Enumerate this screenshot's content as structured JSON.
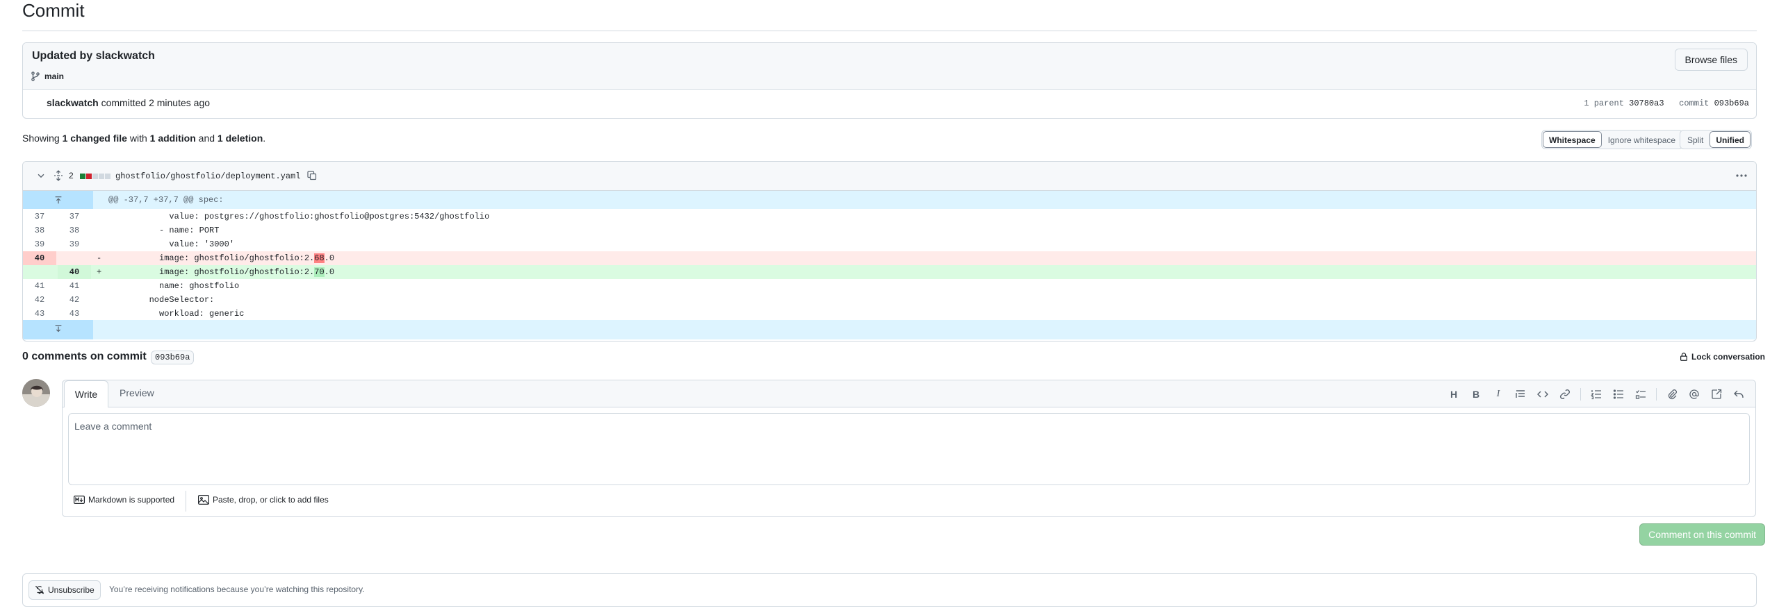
{
  "page": {
    "title": "Commit"
  },
  "commit": {
    "message": "Updated by slackwatch",
    "branch": "main",
    "browse_label": "Browse files",
    "author": "slackwatch",
    "committed_text": "committed 2 minutes ago",
    "parent_label": "1 parent",
    "parent_sha": "30780a3",
    "commit_label": "commit",
    "commit_sha": "093b69a"
  },
  "summary": {
    "prefix": "Showing",
    "changed": "1 changed file",
    "with": "with",
    "additions": "1 addition",
    "and": "and",
    "deletions": "1 deletion",
    "suffix": "."
  },
  "view_options": {
    "whitespace": "Whitespace",
    "ignore_whitespace": "Ignore whitespace",
    "split": "Split",
    "unified": "Unified"
  },
  "file": {
    "change_count": "2",
    "path": "ghostfolio/ghostfolio/deployment.yaml",
    "hunk_header": "@@ -37,7 +37,7 @@ spec:",
    "lines": [
      {
        "old": "37",
        "new": "37",
        "sign": "",
        "pre": "            value: postgres://ghostfolio:ghostfolio@postgres:5432/ghostfolio",
        "hl": "",
        "post": ""
      },
      {
        "old": "38",
        "new": "38",
        "sign": "",
        "pre": "          - name: PORT",
        "hl": "",
        "post": ""
      },
      {
        "old": "39",
        "new": "39",
        "sign": "",
        "pre": "            value: '3000'",
        "hl": "",
        "post": ""
      },
      {
        "old": "40",
        "new": "",
        "sign": "-",
        "pre": "          image: ghostfolio/ghostfolio:2.",
        "hl": "68",
        "post": ".0"
      },
      {
        "old": "",
        "new": "40",
        "sign": "+",
        "pre": "          image: ghostfolio/ghostfolio:2.",
        "hl": "70",
        "post": ".0"
      },
      {
        "old": "41",
        "new": "41",
        "sign": "",
        "pre": "          name: ghostfolio",
        "hl": "",
        "post": ""
      },
      {
        "old": "42",
        "new": "42",
        "sign": "",
        "pre": "        nodeSelector:",
        "hl": "",
        "post": ""
      },
      {
        "old": "43",
        "new": "43",
        "sign": "",
        "pre": "          workload: generic",
        "hl": "",
        "post": ""
      }
    ]
  },
  "comments": {
    "title": "0 comments on commit",
    "sha": "093b69a",
    "lock_label": "Lock conversation",
    "write_tab": "Write",
    "preview_tab": "Preview",
    "placeholder": "Leave a comment",
    "markdown_note": "Markdown is supported",
    "attach_note": "Paste, drop, or click to add files",
    "submit_label": "Comment on this commit"
  },
  "notifications": {
    "unsubscribe_label": "Unsubscribe",
    "reason": "You’re receiving notifications because you’re watching this repository."
  },
  "colors": {
    "deletion": "#cf222e",
    "addition": "#1a7f37",
    "submit_disabled": "#94d3a2",
    "hunk_bg": "#ddf4ff"
  },
  "icons": {
    "branch": "git-branch-icon",
    "collapse": "chevron-down-icon",
    "expand": "unfold-icon",
    "copy": "copy-icon",
    "kebab": "kebab-horizontal-icon",
    "lock": "lock-icon",
    "bell": "bell-slash-icon"
  }
}
